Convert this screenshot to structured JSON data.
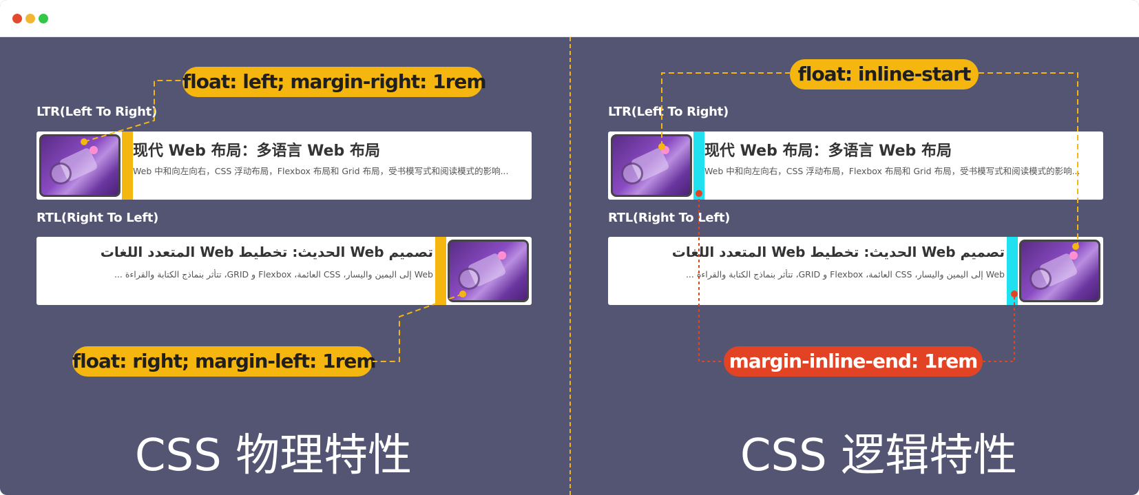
{
  "window": {
    "controls": [
      "close",
      "minimize",
      "maximize"
    ]
  },
  "physical": {
    "ltr_label": "LTR(Left To Right)",
    "rtl_label": "RTL(Right To Left)",
    "ltr_card": {
      "title": "现代 Web 布局：多语言 Web 布局",
      "desc": "Web 中和向左向右，CSS 浮动布局，Flexbox 布局和 Grid 布局，受书模写式和阅读模式的影响..."
    },
    "rtl_card": {
      "title": "تصميم Web الحديث: تخطيط Web المتعدد اللغات",
      "desc": "Web إلى اليمين واليسار، CSS العائمة، Flexbox و GRID، تتأثر بنماذج الكتابة والقراءة ..."
    },
    "pill_top": "float: left; margin-right: 1rem",
    "pill_bottom": "float: right; margin-left: 1rem",
    "caption": "CSS 物理特性"
  },
  "logical": {
    "ltr_label": "LTR(Left To Right)",
    "rtl_label": "RTL(Right To Left)",
    "ltr_card": {
      "title": "现代 Web 布局：多语言 Web 布局",
      "desc": "Web 中和向左向右，CSS 浮动布局，Flexbox 布局和 Grid 布局，受书模写式和阅读模式的影响..."
    },
    "rtl_card": {
      "title": "تصميم Web الحديث: تخطيط Web المتعدد اللغات",
      "desc": "Web إلى اليمين واليسار، CSS العائمة، Flexbox و GRID، تتأثر بنماذج الكتابة والقراءة ..."
    },
    "pill_top": "float: inline-start",
    "pill_bottom": "margin-inline-end: 1rem",
    "caption": "CSS 逻辑特性"
  },
  "colors": {
    "background": "#545573",
    "gold": "#f5b70f",
    "cyan": "#20e1f0",
    "red": "#e24325"
  }
}
